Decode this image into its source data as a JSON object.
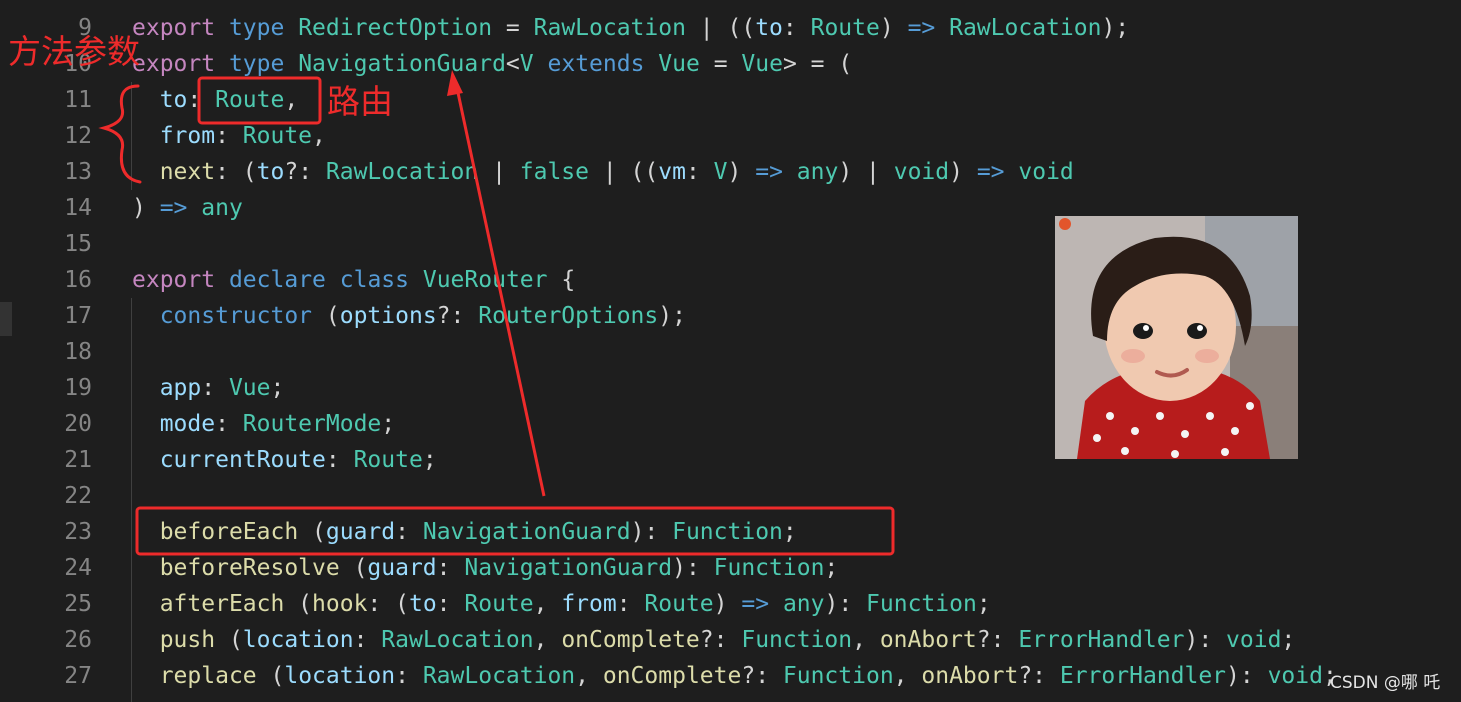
{
  "editor": {
    "lines": [
      {
        "n": "9",
        "tokens": [
          [
            "kw",
            "export"
          ],
          [
            "pu",
            " "
          ],
          [
            "st",
            "type"
          ],
          [
            "pu",
            " "
          ],
          [
            "ty",
            "RedirectOption"
          ],
          [
            "pu",
            " = "
          ],
          [
            "ty",
            "RawLocation"
          ],
          [
            "pu",
            " | (("
          ],
          [
            "pr",
            "to"
          ],
          [
            "pu",
            ": "
          ],
          [
            "ty",
            "Route"
          ],
          [
            "pu",
            ") "
          ],
          [
            "st",
            "=>"
          ],
          [
            "pu",
            " "
          ],
          [
            "ty",
            "RawLocation"
          ],
          [
            "pu",
            ");"
          ]
        ]
      },
      {
        "n": "10",
        "tokens": [
          [
            "kw",
            "export"
          ],
          [
            "pu",
            " "
          ],
          [
            "st",
            "type"
          ],
          [
            "pu",
            " "
          ],
          [
            "ty",
            "NavigationGuard"
          ],
          [
            "pu",
            "<"
          ],
          [
            "ty",
            "V"
          ],
          [
            "pu",
            " "
          ],
          [
            "st",
            "extends"
          ],
          [
            "pu",
            " "
          ],
          [
            "ty",
            "Vue"
          ],
          [
            "pu",
            " = "
          ],
          [
            "ty",
            "Vue"
          ],
          [
            "pu",
            "> = ("
          ]
        ]
      },
      {
        "n": "11",
        "tokens": [
          [
            "pu",
            "  "
          ],
          [
            "pr",
            "to"
          ],
          [
            "pu",
            ": "
          ],
          [
            "ty",
            "Route"
          ],
          [
            "pu",
            ","
          ]
        ]
      },
      {
        "n": "12",
        "tokens": [
          [
            "pu",
            "  "
          ],
          [
            "pr",
            "from"
          ],
          [
            "pu",
            ": "
          ],
          [
            "ty",
            "Route"
          ],
          [
            "pu",
            ","
          ]
        ]
      },
      {
        "n": "13",
        "tokens": [
          [
            "pu",
            "  "
          ],
          [
            "fn",
            "next"
          ],
          [
            "pu",
            ": ("
          ],
          [
            "pr",
            "to"
          ],
          [
            "pu",
            "?: "
          ],
          [
            "ty",
            "RawLocation"
          ],
          [
            "pu",
            " | "
          ],
          [
            "ty",
            "false"
          ],
          [
            "pu",
            " | (("
          ],
          [
            "pr",
            "vm"
          ],
          [
            "pu",
            ": "
          ],
          [
            "ty",
            "V"
          ],
          [
            "pu",
            ") "
          ],
          [
            "st",
            "=>"
          ],
          [
            "pu",
            " "
          ],
          [
            "ty",
            "any"
          ],
          [
            "pu",
            ") | "
          ],
          [
            "ty",
            "void"
          ],
          [
            "pu",
            ") "
          ],
          [
            "st",
            "=>"
          ],
          [
            "pu",
            " "
          ],
          [
            "ty",
            "void"
          ]
        ]
      },
      {
        "n": "14",
        "tokens": [
          [
            "pu",
            ") "
          ],
          [
            "st",
            "=>"
          ],
          [
            "pu",
            " "
          ],
          [
            "ty",
            "any"
          ]
        ]
      },
      {
        "n": "15",
        "tokens": []
      },
      {
        "n": "16",
        "tokens": [
          [
            "kw",
            "export"
          ],
          [
            "pu",
            " "
          ],
          [
            "st",
            "declare"
          ],
          [
            "pu",
            " "
          ],
          [
            "st",
            "class"
          ],
          [
            "pu",
            " "
          ],
          [
            "ty",
            "VueRouter"
          ],
          [
            "pu",
            " {"
          ]
        ]
      },
      {
        "n": "17",
        "tokens": [
          [
            "pu",
            "  "
          ],
          [
            "st",
            "constructor"
          ],
          [
            "pu",
            " ("
          ],
          [
            "pr",
            "options"
          ],
          [
            "pu",
            "?: "
          ],
          [
            "ty",
            "RouterOptions"
          ],
          [
            "pu",
            ");"
          ]
        ]
      },
      {
        "n": "18",
        "tokens": []
      },
      {
        "n": "19",
        "tokens": [
          [
            "pu",
            "  "
          ],
          [
            "pr",
            "app"
          ],
          [
            "pu",
            ": "
          ],
          [
            "ty",
            "Vue"
          ],
          [
            "pu",
            ";"
          ]
        ]
      },
      {
        "n": "20",
        "tokens": [
          [
            "pu",
            "  "
          ],
          [
            "pr",
            "mode"
          ],
          [
            "pu",
            ": "
          ],
          [
            "ty",
            "RouterMode"
          ],
          [
            "pu",
            ";"
          ]
        ]
      },
      {
        "n": "21",
        "tokens": [
          [
            "pu",
            "  "
          ],
          [
            "pr",
            "currentRoute"
          ],
          [
            "pu",
            ": "
          ],
          [
            "ty",
            "Route"
          ],
          [
            "pu",
            ";"
          ]
        ]
      },
      {
        "n": "22",
        "tokens": []
      },
      {
        "n": "23",
        "tokens": [
          [
            "pu",
            "  "
          ],
          [
            "fn",
            "beforeEach"
          ],
          [
            "pu",
            " ("
          ],
          [
            "pr",
            "guard"
          ],
          [
            "pu",
            ": "
          ],
          [
            "ty",
            "NavigationGuard"
          ],
          [
            "pu",
            "): "
          ],
          [
            "ty",
            "Function"
          ],
          [
            "pu",
            ";"
          ]
        ]
      },
      {
        "n": "24",
        "tokens": [
          [
            "pu",
            "  "
          ],
          [
            "fn",
            "beforeResolve"
          ],
          [
            "pu",
            " ("
          ],
          [
            "pr",
            "guard"
          ],
          [
            "pu",
            ": "
          ],
          [
            "ty",
            "NavigationGuard"
          ],
          [
            "pu",
            "): "
          ],
          [
            "ty",
            "Function"
          ],
          [
            "pu",
            ";"
          ]
        ]
      },
      {
        "n": "25",
        "tokens": [
          [
            "pu",
            "  "
          ],
          [
            "fn",
            "afterEach"
          ],
          [
            "pu",
            " ("
          ],
          [
            "fn",
            "hook"
          ],
          [
            "pu",
            ": ("
          ],
          [
            "pr",
            "to"
          ],
          [
            "pu",
            ": "
          ],
          [
            "ty",
            "Route"
          ],
          [
            "pu",
            ", "
          ],
          [
            "pr",
            "from"
          ],
          [
            "pu",
            ": "
          ],
          [
            "ty",
            "Route"
          ],
          [
            "pu",
            ") "
          ],
          [
            "st",
            "=>"
          ],
          [
            "pu",
            " "
          ],
          [
            "ty",
            "any"
          ],
          [
            "pu",
            "): "
          ],
          [
            "ty",
            "Function"
          ],
          [
            "pu",
            ";"
          ]
        ]
      },
      {
        "n": "26",
        "tokens": [
          [
            "pu",
            "  "
          ],
          [
            "fn",
            "push"
          ],
          [
            "pu",
            " ("
          ],
          [
            "pr",
            "location"
          ],
          [
            "pu",
            ": "
          ],
          [
            "ty",
            "RawLocation"
          ],
          [
            "pu",
            ", "
          ],
          [
            "fn",
            "onComplete"
          ],
          [
            "pu",
            "?: "
          ],
          [
            "ty",
            "Function"
          ],
          [
            "pu",
            ", "
          ],
          [
            "fn",
            "onAbort"
          ],
          [
            "pu",
            "?: "
          ],
          [
            "ty",
            "ErrorHandler"
          ],
          [
            "pu",
            "): "
          ],
          [
            "ty",
            "void"
          ],
          [
            "pu",
            ";"
          ]
        ]
      },
      {
        "n": "27",
        "tokens": [
          [
            "pu",
            "  "
          ],
          [
            "fn",
            "replace"
          ],
          [
            "pu",
            " ("
          ],
          [
            "pr",
            "location"
          ],
          [
            "pu",
            ": "
          ],
          [
            "ty",
            "RawLocation"
          ],
          [
            "pu",
            ", "
          ],
          [
            "fn",
            "onComplete"
          ],
          [
            "pu",
            "?: "
          ],
          [
            "ty",
            "Function"
          ],
          [
            "pu",
            ", "
          ],
          [
            "fn",
            "onAbort"
          ],
          [
            "pu",
            "?: "
          ],
          [
            "ty",
            "ErrorHandler"
          ],
          [
            "pu",
            "): "
          ],
          [
            "ty",
            "void"
          ],
          [
            "pu",
            ";"
          ]
        ]
      }
    ]
  },
  "annotations": {
    "method_params_label": "方法参数",
    "route_label": "路由",
    "color": "#ee2b2b"
  },
  "watermark": "CSDN @哪 吒"
}
